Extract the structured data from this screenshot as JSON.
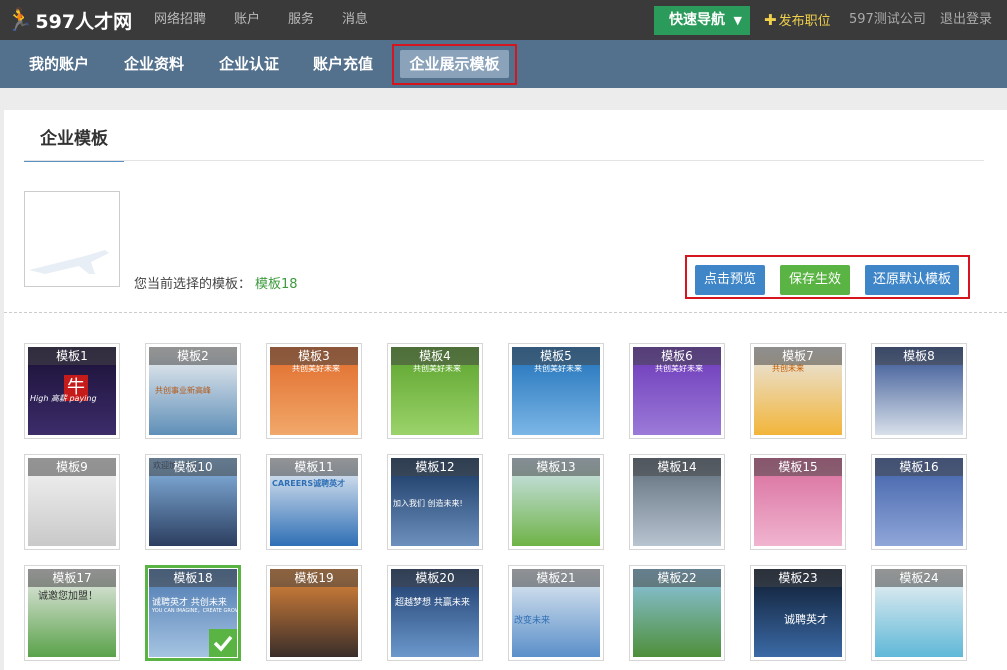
{
  "topbar": {
    "logo": "597人才网",
    "nav": [
      "网络招聘",
      "账户",
      "服务",
      "消息"
    ],
    "quick_nav": "快速导航",
    "post_job": "发布职位",
    "company": "597测试公司",
    "logout": "退出登录"
  },
  "subnav": {
    "items": [
      "我的账户",
      "企业资料",
      "企业认证",
      "账户充值"
    ],
    "active": "企业展示模板"
  },
  "panel": {
    "title": "企业模板",
    "current_label": "您当前选择的模板：",
    "current_value": "模板18",
    "buttons": {
      "preview": "点击预览",
      "save": "保存生效",
      "restore": "还原默认模板"
    }
  },
  "templates": [
    {
      "label": "模板1",
      "colors": [
        "#1a1035",
        "#3c2c6a"
      ]
    },
    {
      "label": "模板2",
      "colors": [
        "#f4f4f4",
        "#5f8fb8"
      ]
    },
    {
      "label": "模板3",
      "colors": [
        "#e06a2a",
        "#f1a86a"
      ]
    },
    {
      "label": "模板4",
      "colors": [
        "#5aa22c",
        "#9bd36a"
      ]
    },
    {
      "label": "模板5",
      "colors": [
        "#1c6fb8",
        "#7cb6e6"
      ]
    },
    {
      "label": "模板6",
      "colors": [
        "#6b37b8",
        "#9b7ad8"
      ]
    },
    {
      "label": "模板7",
      "colors": [
        "#e8e8e8",
        "#f2b53a"
      ]
    },
    {
      "label": "模板8",
      "colors": [
        "#2e4d8f",
        "#d8e0ea"
      ]
    },
    {
      "label": "模板9",
      "colors": [
        "#f4f4f4",
        "#c9c9c9"
      ]
    },
    {
      "label": "模板10",
      "colors": [
        "#8bbbe8",
        "#2c3e60"
      ]
    },
    {
      "label": "模板11",
      "colors": [
        "#f1f4f8",
        "#2f6fb5"
      ]
    },
    {
      "label": "模板12",
      "colors": [
        "#14345e",
        "#6c90bd"
      ]
    },
    {
      "label": "模板13",
      "colors": [
        "#d3e6f5",
        "#6fb347"
      ]
    },
    {
      "label": "模板14",
      "colors": [
        "#5d6b7a",
        "#b8c4d0"
      ]
    },
    {
      "label": "模板15",
      "colors": [
        "#d86c9c",
        "#f0b4cf"
      ]
    },
    {
      "label": "模板16",
      "colors": [
        "#3e5fa8",
        "#8fa6d8"
      ]
    },
    {
      "label": "模板17",
      "colors": [
        "#ececec",
        "#5aa24a"
      ]
    },
    {
      "label": "模板18",
      "colors": [
        "#4a78b0",
        "#a6c4e2"
      ]
    },
    {
      "label": "模板19",
      "colors": [
        "#e5893a",
        "#3a2e2a"
      ]
    },
    {
      "label": "模板20",
      "colors": [
        "#1a3868",
        "#6c98cc"
      ]
    },
    {
      "label": "模板21",
      "colors": [
        "#e8eef4",
        "#5a8fc9"
      ]
    },
    {
      "label": "模板22",
      "colors": [
        "#8fc6e8",
        "#4e8f3a"
      ]
    },
    {
      "label": "模板23",
      "colors": [
        "#0d1a2e",
        "#3b6aa6"
      ]
    },
    {
      "label": "模板24",
      "colors": [
        "#f4f4f4",
        "#5fb8d8"
      ]
    }
  ],
  "selected_template_label": "模板18",
  "thumb_text": {
    "t1_big": "牛",
    "t1_small": "High 高薪 paying",
    "t2": "共创事业新高峰",
    "t3": "共创美好未来",
    "t4": "共创美好未来",
    "t5": "共创美好未来",
    "t6": "共创美好未来",
    "t7": "共创未来",
    "t10": "欢迎加入我们",
    "t11": "CAREERS诚聘英才",
    "t12": "加入我们 创造未来!",
    "t17": "诚邀您加盟！",
    "t18_main": "诚聘英才 共创未来",
    "t18_sub": "YOU CAN IMAGINE，CREATE GROW WITHIN",
    "t20": "超越梦想 共赢未来",
    "t21": "改变未来",
    "t23": "诚聘英才"
  },
  "icons": {
    "logo": "runner-icon",
    "quick_nav_arrow": "chevron-down-icon",
    "post_job_icon": "plus-icon",
    "selected": "checkmark-icon"
  }
}
